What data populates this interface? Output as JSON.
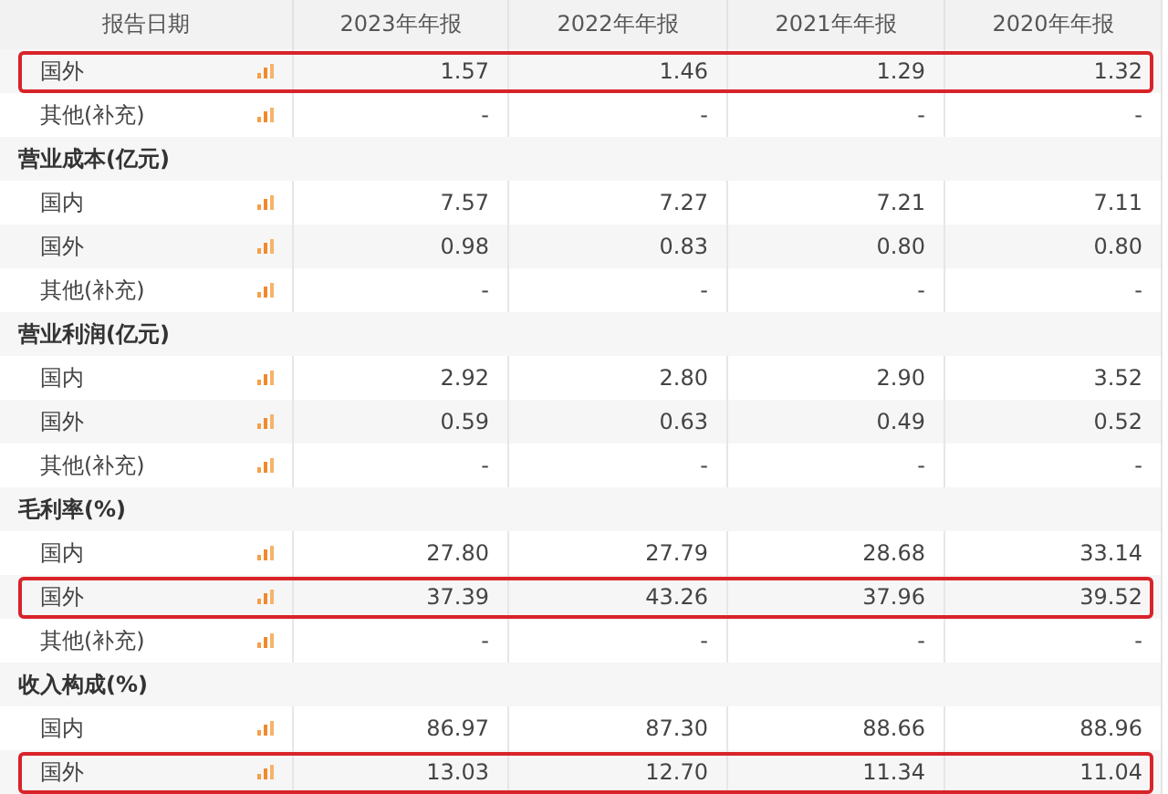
{
  "table": {
    "columns": [
      "报告日期",
      "2023年年报",
      "2022年年报",
      "2021年年报",
      "2020年年报"
    ],
    "rows": [
      {
        "kind": "item",
        "label": "国外",
        "values": [
          "1.57",
          "1.46",
          "1.29",
          "1.32"
        ],
        "highlighted": true
      },
      {
        "kind": "item",
        "label": "其他(补充)",
        "values": [
          "-",
          "-",
          "-",
          "-"
        ],
        "highlighted": false
      },
      {
        "kind": "section",
        "label": "营业成本(亿元)"
      },
      {
        "kind": "item",
        "label": "国内",
        "values": [
          "7.57",
          "7.27",
          "7.21",
          "7.11"
        ],
        "highlighted": false
      },
      {
        "kind": "item",
        "label": "国外",
        "values": [
          "0.98",
          "0.83",
          "0.80",
          "0.80"
        ],
        "highlighted": false
      },
      {
        "kind": "item",
        "label": "其他(补充)",
        "values": [
          "-",
          "-",
          "-",
          "-"
        ],
        "highlighted": false
      },
      {
        "kind": "section",
        "label": "营业利润(亿元)"
      },
      {
        "kind": "item",
        "label": "国内",
        "values": [
          "2.92",
          "2.80",
          "2.90",
          "3.52"
        ],
        "highlighted": false
      },
      {
        "kind": "item",
        "label": "国外",
        "values": [
          "0.59",
          "0.63",
          "0.49",
          "0.52"
        ],
        "highlighted": false
      },
      {
        "kind": "item",
        "label": "其他(补充)",
        "values": [
          "-",
          "-",
          "-",
          "-"
        ],
        "highlighted": false
      },
      {
        "kind": "section",
        "label": "毛利率(%)"
      },
      {
        "kind": "item",
        "label": "国内",
        "values": [
          "27.80",
          "27.79",
          "28.68",
          "33.14"
        ],
        "highlighted": false
      },
      {
        "kind": "item",
        "label": "国外",
        "values": [
          "37.39",
          "43.26",
          "37.96",
          "39.52"
        ],
        "highlighted": true
      },
      {
        "kind": "item",
        "label": "其他(补充)",
        "values": [
          "-",
          "-",
          "-",
          "-"
        ],
        "highlighted": false
      },
      {
        "kind": "section",
        "label": "收入构成(%)"
      },
      {
        "kind": "item",
        "label": "国内",
        "values": [
          "86.97",
          "87.30",
          "88.66",
          "88.96"
        ],
        "highlighted": false
      },
      {
        "kind": "item",
        "label": "国外",
        "values": [
          "13.03",
          "12.70",
          "11.34",
          "11.04"
        ],
        "highlighted": true
      }
    ]
  }
}
